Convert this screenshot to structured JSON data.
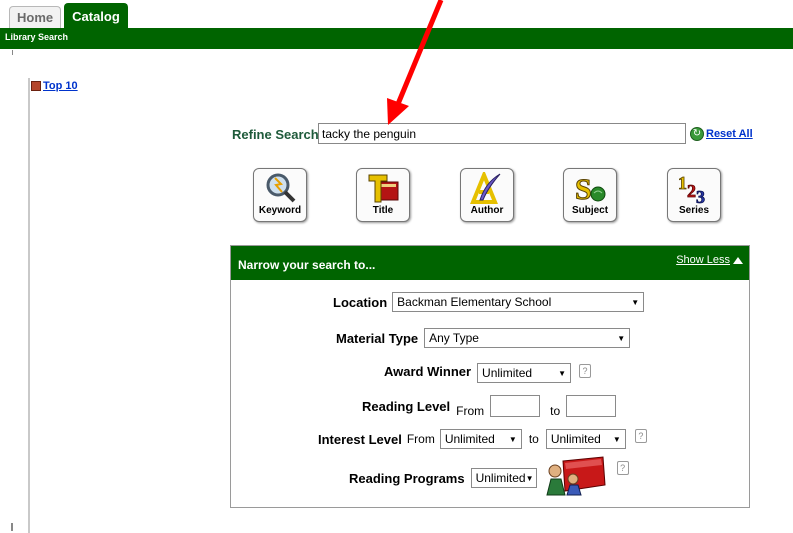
{
  "tabs": {
    "home": "Home",
    "catalog": "Catalog"
  },
  "breadcrumb": "Library Search",
  "top10": "Top 10",
  "refine": {
    "label": "Refine Search",
    "value": "tacky the penguin",
    "reset": "Reset All"
  },
  "search_buttons": {
    "keyword": "Keyword",
    "title": "Title",
    "author": "Author",
    "subject": "Subject",
    "series": "Series"
  },
  "narrow": {
    "title": "Narrow your search to...",
    "show_less": "Show Less",
    "location": {
      "label": "Location",
      "value": "Backman Elementary School"
    },
    "material_type": {
      "label": "Material Type",
      "value": "Any Type"
    },
    "award_winner": {
      "label": "Award Winner",
      "value": "Unlimited"
    },
    "reading_level": {
      "label": "Reading Level",
      "from": "From",
      "to": "to"
    },
    "interest_level": {
      "label": "Interest Level",
      "from": "From",
      "from_value": "Unlimited",
      "to": "to",
      "to_value": "Unlimited"
    },
    "reading_programs": {
      "label": "Reading Programs",
      "value": "Unlimited"
    },
    "help": "?"
  },
  "colors": {
    "brand_green": "#006400",
    "link_blue": "#0033cc",
    "annotation_arrow": "#ff0000"
  }
}
